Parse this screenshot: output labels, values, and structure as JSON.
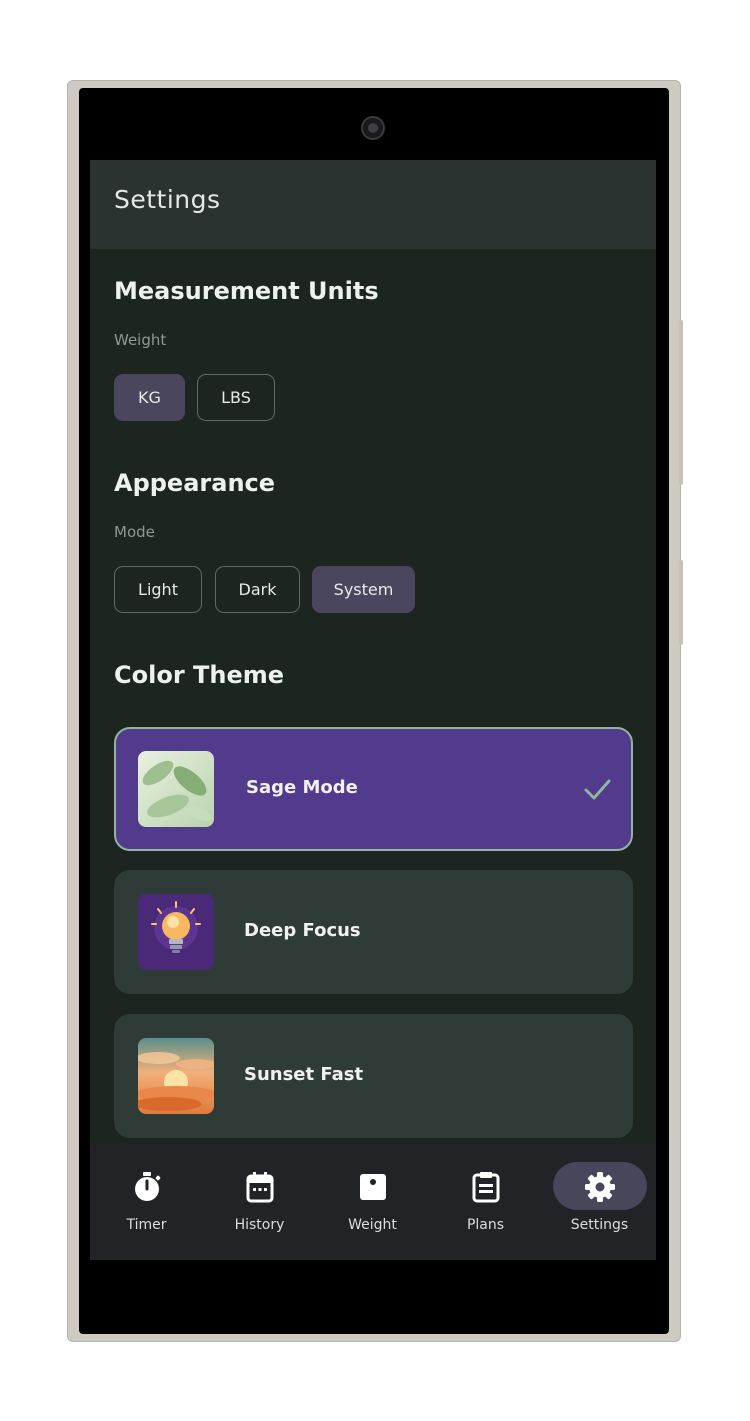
{
  "app_bar": {
    "title": "Settings"
  },
  "measurement": {
    "title": "Measurement Units",
    "label": "Weight",
    "options": [
      "KG",
      "LBS"
    ],
    "selected": "KG"
  },
  "appearance": {
    "title": "Appearance",
    "label": "Mode",
    "options": [
      "Light",
      "Dark",
      "System"
    ],
    "selected": "System"
  },
  "color_theme": {
    "title": "Color Theme",
    "themes": [
      {
        "name": "Sage Mode",
        "selected": true,
        "thumb": "leaf-image"
      },
      {
        "name": "Deep Focus",
        "selected": false,
        "thumb": "lightbulb-image"
      },
      {
        "name": "Sunset Fast",
        "selected": false,
        "thumb": "sunset-image"
      }
    ]
  },
  "nav": {
    "items": [
      {
        "label": "Timer",
        "icon": "stopwatch-icon"
      },
      {
        "label": "History",
        "icon": "calendar-icon"
      },
      {
        "label": "Weight",
        "icon": "scale-icon"
      },
      {
        "label": "Plans",
        "icon": "document-icon"
      },
      {
        "label": "Settings",
        "icon": "gear-icon",
        "active": true
      }
    ]
  },
  "colors": {
    "background": "#1d2521",
    "app_bar": "#2a3330",
    "selected_chip": "#4a465e",
    "selected_theme": "#523a8c",
    "theme_card": "#2f3b37",
    "accent_border": "#8fb59f",
    "nav_bg": "#222326",
    "nav_pill": "#47465a"
  }
}
